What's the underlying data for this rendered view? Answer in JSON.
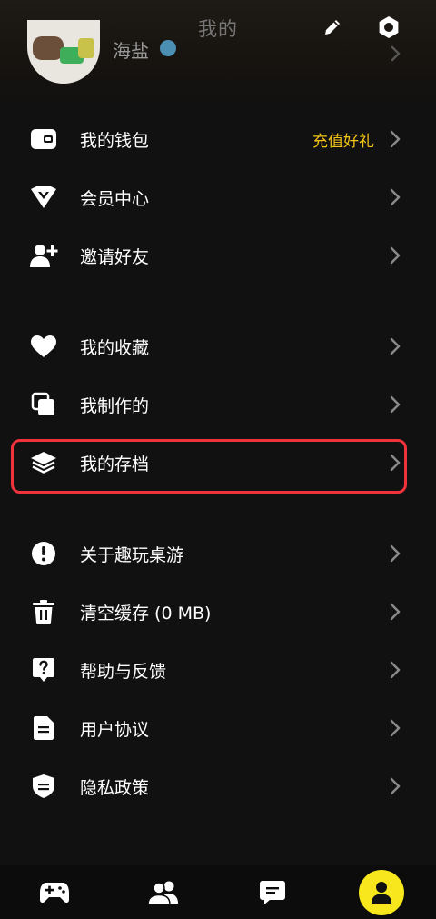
{
  "header": {
    "title": "我的",
    "username": "海盐"
  },
  "menu": {
    "group1": [
      {
        "label": "我的钱包",
        "extra": "充值好礼",
        "icon": "wallet-icon"
      },
      {
        "label": "会员中心",
        "icon": "vip-diamond-icon"
      },
      {
        "label": "邀请好友",
        "icon": "add-user-icon"
      }
    ],
    "group2": [
      {
        "label": "我的收藏",
        "icon": "heart-icon"
      },
      {
        "label": "我制作的",
        "icon": "copy-icon"
      },
      {
        "label": "我的存档",
        "icon": "layers-icon"
      }
    ],
    "group3": [
      {
        "label": "关于趣玩桌游",
        "icon": "info-icon"
      },
      {
        "label": "清空缓存 (0 MB)",
        "icon": "trash-icon"
      },
      {
        "label": "帮助与反馈",
        "icon": "help-icon"
      },
      {
        "label": "用户协议",
        "icon": "document-icon"
      },
      {
        "label": "隐私政策",
        "icon": "shield-icon"
      }
    ]
  },
  "bottom_nav": [
    {
      "icon": "gamepad-icon"
    },
    {
      "icon": "friends-icon"
    },
    {
      "icon": "message-icon"
    },
    {
      "icon": "profile-icon",
      "active": true
    }
  ],
  "colors": {
    "background": "#111111",
    "accent_yellow": "#f5c518",
    "nav_active": "#f8e71c",
    "highlight_border": "#f0323c"
  }
}
